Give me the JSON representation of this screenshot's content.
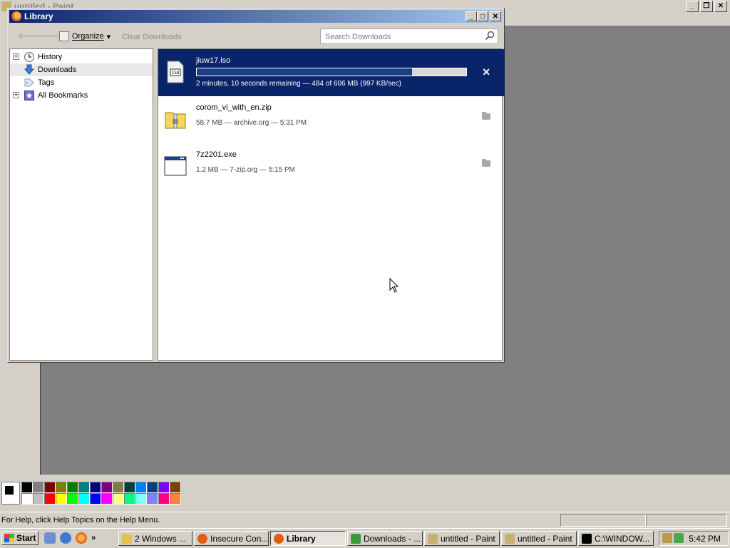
{
  "paint": {
    "title": "untitled - Paint",
    "status_text": "For Help, click Help Topics on the Help Menu.",
    "palette_top": [
      "#000000",
      "#808080",
      "#800000",
      "#808000",
      "#008000",
      "#008080",
      "#000080",
      "#800080",
      "#808040",
      "#004040",
      "#0080ff",
      "#004080",
      "#8000ff",
      "#804000"
    ],
    "palette_bottom": [
      "#ffffff",
      "#c0c0c0",
      "#ff0000",
      "#ffff00",
      "#00ff00",
      "#00ffff",
      "#0000ff",
      "#ff00ff",
      "#ffff80",
      "#00ff80",
      "#80ffff",
      "#8080ff",
      "#ff0080",
      "#ff8040"
    ]
  },
  "library": {
    "title": "Library",
    "toolbar": {
      "back_icon": "back-arrow-icon",
      "forward_icon": "forward-arrow-icon",
      "organize_label": "Organize",
      "organize_chevron": "▾",
      "clear_label": "Clear Downloads",
      "search_placeholder": "Search Downloads"
    },
    "tree": [
      {
        "label": "History",
        "icon": "clock-icon",
        "expandable": true,
        "selected": false
      },
      {
        "label": "Downloads",
        "icon": "download-arrow-icon",
        "expandable": false,
        "selected": true
      },
      {
        "label": "Tags",
        "icon": "tag-icon",
        "expandable": false,
        "selected": false
      },
      {
        "label": "All Bookmarks",
        "icon": "bookmarks-star-icon",
        "expandable": true,
        "selected": false
      }
    ],
    "downloads": [
      {
        "name": "jiuw17.iso",
        "status": "2 minutes, 10 seconds remaining — 484 of 606 MB (997 KB/sec)",
        "progress_percent": 80,
        "active": true,
        "icon": "iso-file-icon"
      },
      {
        "name": "corom_vi_with_en.zip",
        "status": "58.7 MB — archive.org — 5:31 PM",
        "active": false,
        "icon": "zip-archive-icon"
      },
      {
        "name": "7z2201.exe",
        "status": "1.2 MB — 7-zip.org — 5:15 PM",
        "active": false,
        "icon": "exe-window-icon"
      }
    ]
  },
  "taskbar": {
    "start_label": "Start",
    "quick_launch_more": "»",
    "buttons": [
      {
        "label": "2 Windows ...",
        "icon": "folder-icon",
        "color": "#e6c050",
        "active": false
      },
      {
        "label": "Insecure Con...",
        "icon": "firefox-icon",
        "color": "#e55b13",
        "active": false
      },
      {
        "label": "Library",
        "icon": "firefox-icon",
        "color": "#e55b13",
        "active": true
      },
      {
        "label": "Downloads - ...",
        "icon": "downloads-icon",
        "color": "#3a9a3a",
        "active": false
      },
      {
        "label": "untitled - Paint",
        "icon": "paint-icon",
        "color": "#c8b070",
        "active": false
      },
      {
        "label": "untitled - Paint",
        "icon": "paint-icon",
        "color": "#c8b070",
        "active": false
      },
      {
        "label": "C:\\WINDOW...",
        "icon": "cmd-icon",
        "color": "#000000",
        "active": false
      }
    ],
    "clock": "5:42 PM"
  }
}
